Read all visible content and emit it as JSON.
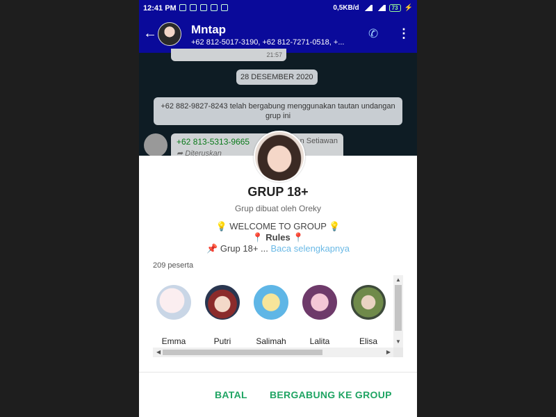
{
  "status_bar": {
    "time": "12:41 PM",
    "net_speed": "0,5KB/d",
    "battery": "73"
  },
  "app_bar": {
    "title": "Mntap",
    "subtitle": "+62 812-5017-3190, +62 812-7271-0518, +...",
    "back_icon": "arrow-left-icon",
    "call_icon": "add-call-icon",
    "more_icon": "more-vert-icon"
  },
  "chat": {
    "prev_message_time": "21:57",
    "date_chip": "28 DESEMBER 2020",
    "system_message": "+62 882-9827-8243 telah bergabung menggunakan tautan undangan grup ini",
    "incoming": {
      "sender_number": "+62 813-5313-9665",
      "sender_name": "n Setiawan",
      "forwarded_label": "Diteruskan"
    }
  },
  "sheet": {
    "group_name": "GRUP 18+",
    "creator": "Grup dibuat oleh Oreky",
    "description_line1": "WELCOME TO GROUP",
    "description_line2": "Rules",
    "description_line3": "Grup 18+ ...",
    "read_more": "Baca selengkapnya",
    "member_count": "209 peserta",
    "members": [
      {
        "name": "Emma"
      },
      {
        "name": "Putri"
      },
      {
        "name": "Salimah"
      },
      {
        "name": "Lalita"
      },
      {
        "name": "Elisa"
      }
    ],
    "cancel_label": "BATAL",
    "join_label": "BERGABUNG KE GROUP"
  },
  "colors": {
    "app_bar": "#0a0a9a",
    "accent_green": "#1fa463",
    "link_blue": "#6ab9e6"
  }
}
